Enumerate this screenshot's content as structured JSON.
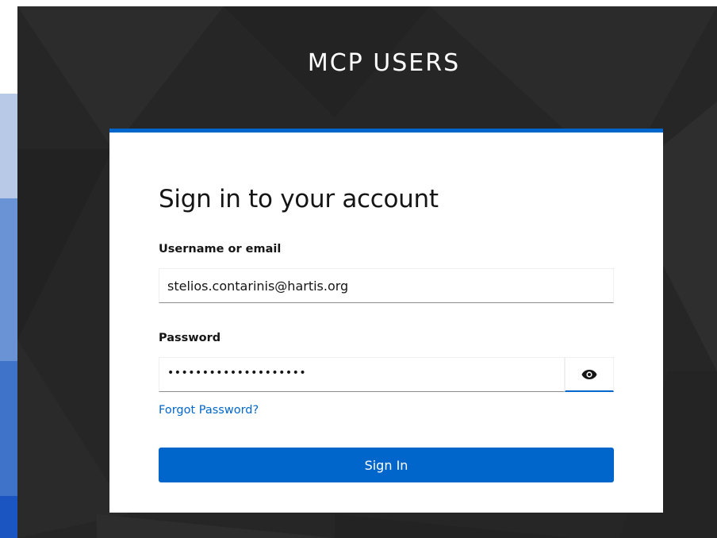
{
  "header": {
    "brand": "MCP USERS"
  },
  "login": {
    "title": "Sign in to your account",
    "username_label": "Username or email",
    "username_value": "stelios.contarinis@hartis.org",
    "password_label": "Password",
    "password_value": "••••••••••••••••••••",
    "show_password_icon": "eye-icon",
    "forgot_password": "Forgot Password?",
    "submit_label": "Sign In"
  },
  "colors": {
    "accent": "#0066cc",
    "backdrop": "#262626",
    "card": "#ffffff"
  }
}
